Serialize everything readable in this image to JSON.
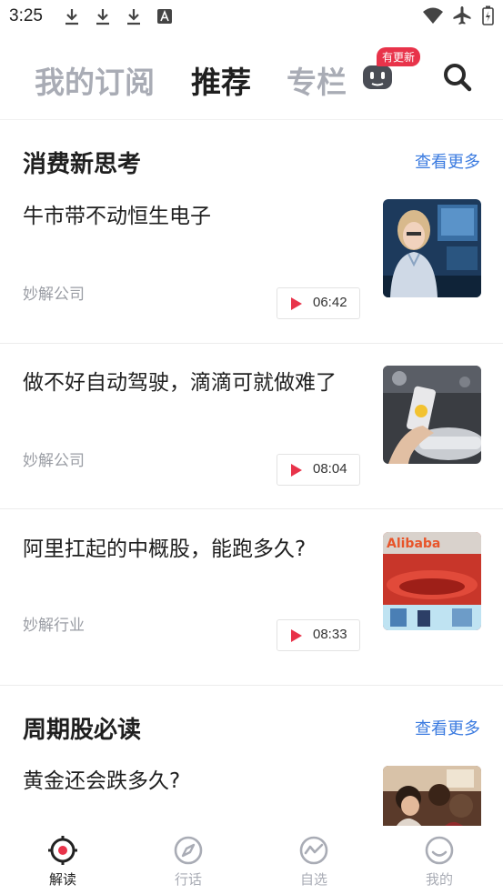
{
  "status_bar": {
    "time": "3:25"
  },
  "top_nav": {
    "tabs": [
      {
        "label": "我的订阅"
      },
      {
        "label": "推荐"
      },
      {
        "label": "专栏"
      }
    ],
    "update_badge": "有更新"
  },
  "sections": [
    {
      "title": "消费新思考",
      "more": "查看更多",
      "articles": [
        {
          "title": "牛市带不动恒生电子",
          "source": "妙解公司",
          "duration": "06:42"
        },
        {
          "title": "做不好自动驾驶，滴滴可就做难了",
          "source": "妙解公司",
          "duration": "08:04"
        },
        {
          "title": "阿里扛起的中概股，能跑多久?",
          "source": "妙解行业",
          "duration": "08:33"
        }
      ]
    },
    {
      "title": "周期股必读",
      "more": "查看更多",
      "articles": [
        {
          "title": "黄金还会跌多久?"
        }
      ]
    }
  ],
  "thumb_text": {
    "alibaba": "Alibaba"
  },
  "bottom_nav": [
    {
      "label": "解读"
    },
    {
      "label": "行话"
    },
    {
      "label": "自选"
    },
    {
      "label": "我的"
    }
  ],
  "colors": {
    "accent_red": "#e8334a",
    "link_blue": "#3b7be0",
    "inactive_gray": "#a9acb5"
  }
}
